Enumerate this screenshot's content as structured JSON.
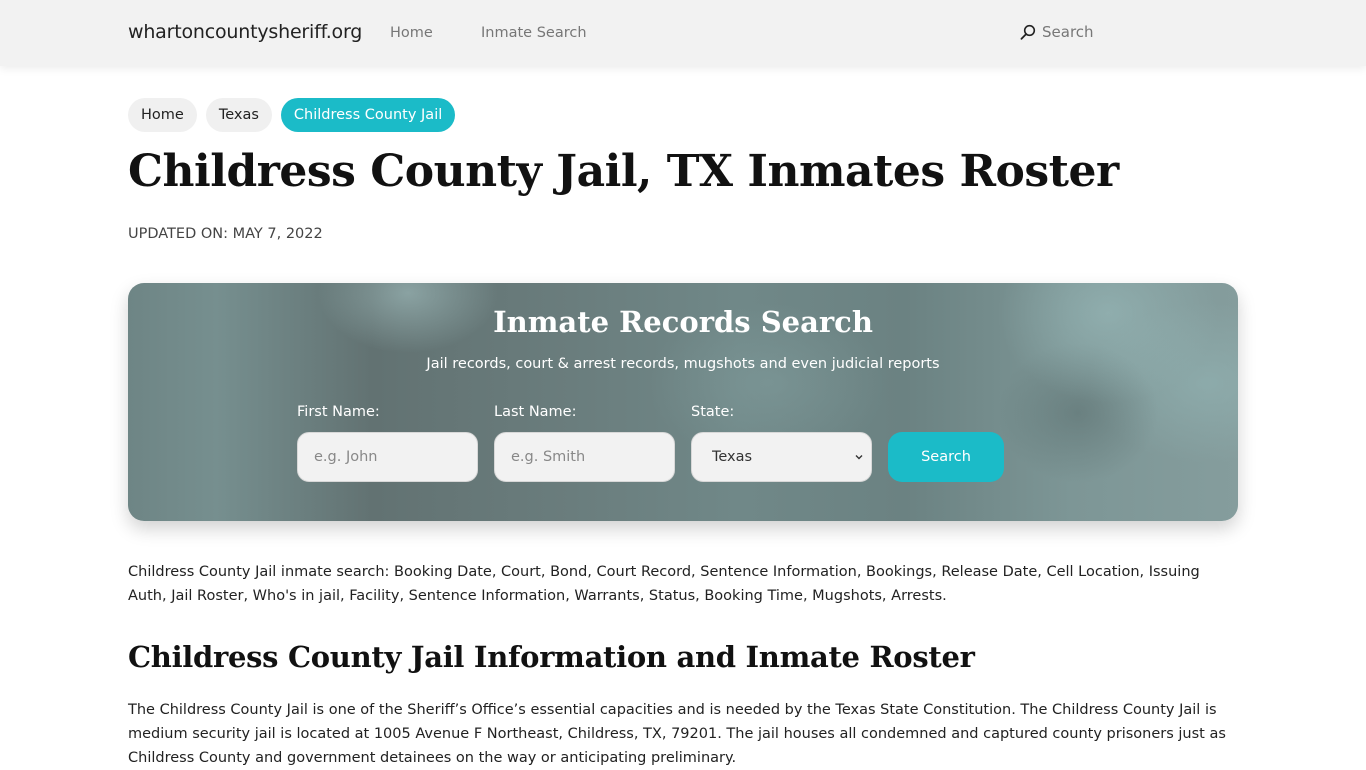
{
  "navbar": {
    "brand": "whartoncountysheriff.org",
    "links": [
      {
        "label": "Home"
      },
      {
        "label": "Inmate Search"
      }
    ],
    "search_label": "Search",
    "search_icon": "search-icon"
  },
  "breadcrumb": [
    {
      "label": "Home",
      "active": false
    },
    {
      "label": "Texas",
      "active": false
    },
    {
      "label": "Childress County Jail",
      "active": true
    }
  ],
  "page": {
    "title": "Childress County Jail, TX Inmates Roster",
    "updated": "UPDATED ON: MAY 7, 2022"
  },
  "search_card": {
    "title": "Inmate Records Search",
    "subtitle": "Jail records, court & arrest records, mugshots and even judicial reports",
    "first_name": {
      "label": "First Name:",
      "placeholder": "e.g. John",
      "value": ""
    },
    "last_name": {
      "label": "Last Name:",
      "placeholder": "e.g. Smith",
      "value": ""
    },
    "state": {
      "label": "State:",
      "selected": "Texas"
    },
    "button_label": "Search"
  },
  "content": {
    "intro": "Childress County Jail inmate search: Booking Date, Court, Bond, Court Record, Sentence Information, Bookings, Release Date, Cell Location, Issuing Auth, Jail Roster, Who's in jail, Facility, Sentence Information, Warrants, Status, Booking Time, Mugshots, Arrests.",
    "section_title": "Childress County Jail Information and Inmate Roster",
    "paragraph": "The Childress County Jail is one of the Sheriff’s Office’s essential capacities and is needed by the Texas State Constitution. The Childress County Jail is medium security jail is located at 1005 Avenue F Northeast, Childress, TX, 79201. The jail houses all condemned and captured county prisoners just as Childress County and government detainees on the way or anticipating preliminary."
  },
  "colors": {
    "accent": "#1bbbc8",
    "navbar_bg": "#f2f2f2",
    "text": "#222222"
  }
}
